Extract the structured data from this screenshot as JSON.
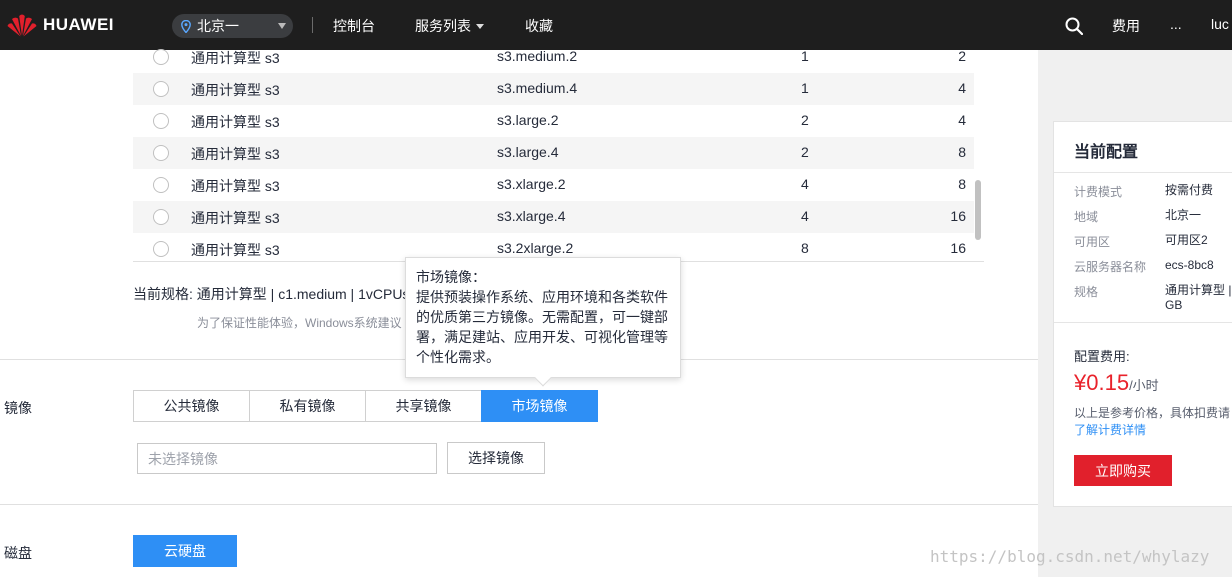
{
  "header": {
    "brand": "HUAWEI",
    "region": "北京一",
    "nav": [
      "控制台",
      "服务列表",
      "收藏"
    ],
    "fee": "费用",
    "more": "...",
    "user": "luc"
  },
  "spec_table": {
    "rows": [
      {
        "type": "通用计算型 s3",
        "spec": "s3.medium.2",
        "vcpus": "1",
        "memory": "2"
      },
      {
        "type": "通用计算型 s3",
        "spec": "s3.medium.4",
        "vcpus": "1",
        "memory": "4"
      },
      {
        "type": "通用计算型 s3",
        "spec": "s3.large.2",
        "vcpus": "2",
        "memory": "4"
      },
      {
        "type": "通用计算型 s3",
        "spec": "s3.large.4",
        "vcpus": "2",
        "memory": "8"
      },
      {
        "type": "通用计算型 s3",
        "spec": "s3.xlarge.2",
        "vcpus": "4",
        "memory": "8"
      },
      {
        "type": "通用计算型 s3",
        "spec": "s3.xlarge.4",
        "vcpus": "4",
        "memory": "16"
      },
      {
        "type": "通用计算型 s3",
        "spec": "s3.2xlarge.2",
        "vcpus": "8",
        "memory": "16"
      }
    ]
  },
  "current_spec": "当前规格: 通用计算型 | c1.medium | 1vCPUs",
  "hint": "为了保证性能体验，Windows系统建议",
  "tooltip": {
    "title": "市场镜像：",
    "body": "提供预装操作系统、应用环境和各类软件的优质第三方镜像。无需配置，可一键部署，满足建站、应用开发、可视化管理等个性化需求。"
  },
  "image": {
    "label": "镜像",
    "tabs": [
      "公共镜像",
      "私有镜像",
      "共享镜像",
      "市场镜像"
    ],
    "active_tab": "市场镜像",
    "placeholder": "未选择镜像",
    "select_button": "选择镜像"
  },
  "disk": {
    "label": "磁盘",
    "button": "云硬盘"
  },
  "config": {
    "title": "当前配置",
    "items": [
      {
        "k": "计费模式",
        "v": "按需付费"
      },
      {
        "k": "地域",
        "v": "北京一"
      },
      {
        "k": "可用区",
        "v": "可用区2"
      },
      {
        "k": "云服务器名称",
        "v": "ecs-8bc8"
      },
      {
        "k": "规格",
        "v": "通用计算型 |"
      }
    ],
    "spec_extra": "GB",
    "fee_label": "配置费用:",
    "price": "¥0.15",
    "price_unit": "/小时",
    "ref": "以上是参考价格，具体扣费请",
    "link": "了解计费详情",
    "buy": "立即购买"
  },
  "watermark": "https://blog.csdn.net/whylazy",
  "colors": {
    "topbar": "#1e1e1e",
    "accent": "#2e8ff5",
    "price": "#e9222b",
    "buy": "#e1202c",
    "logo": "#e1202c"
  }
}
